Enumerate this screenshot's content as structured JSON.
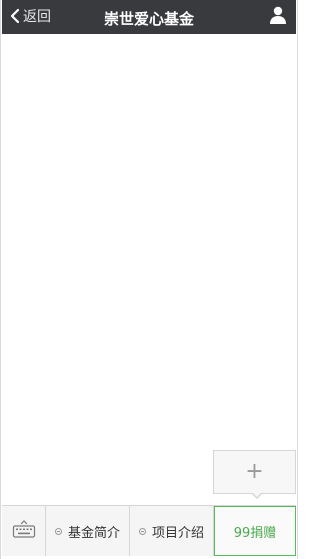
{
  "header": {
    "back_label": "返回",
    "title": "崇世爱心基金"
  },
  "popup": {
    "plus_symbol": "+"
  },
  "bottom_bar": {
    "menu_items": [
      {
        "label": "基金简介"
      },
      {
        "label": "项目介绍"
      }
    ],
    "donate_label": "99捐赠"
  },
  "icons": {
    "back": "chevron-left-icon",
    "user": "user-icon",
    "keyboard": "keyboard-icon",
    "plus": "plus-icon"
  },
  "colors": {
    "header_bg": "#393a3e",
    "donate_accent": "#4aa94a"
  }
}
